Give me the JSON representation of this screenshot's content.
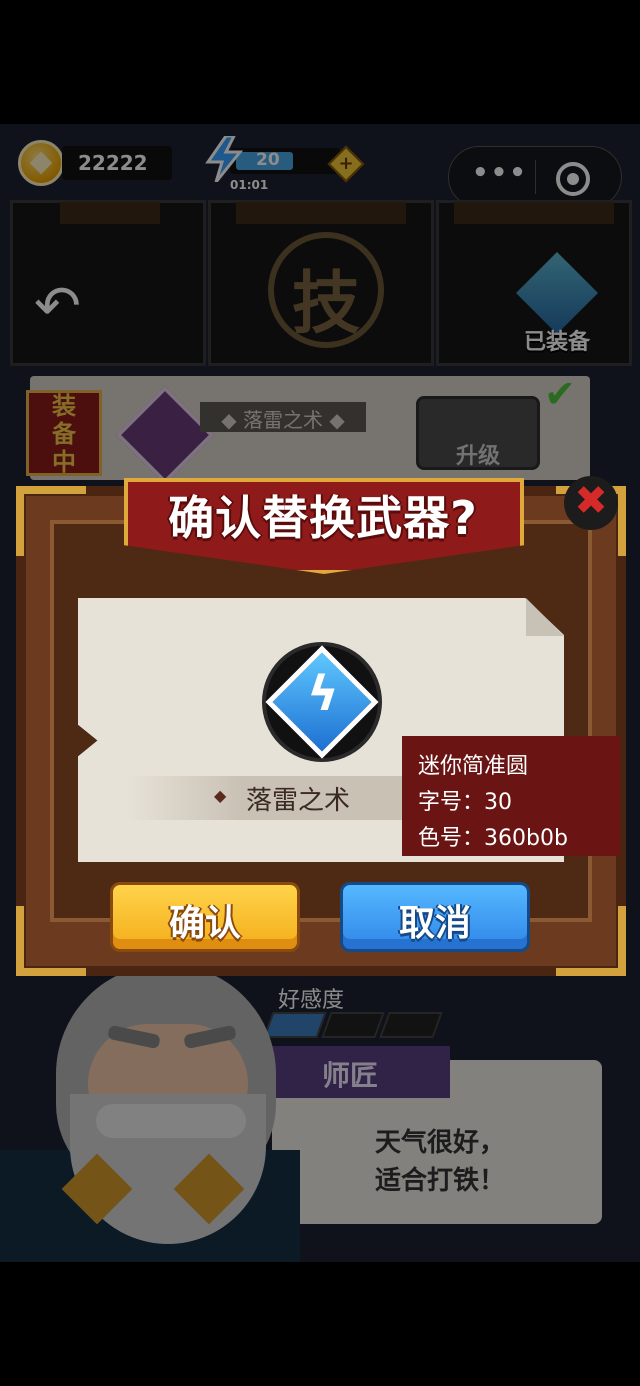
{
  "status_bar": {
    "coins": "22222",
    "energy": "20",
    "energy_timer": "01:01",
    "energy_fill_fraction": 0.55,
    "more_icon": "•••",
    "plus_icon": "+"
  },
  "header": {
    "back_icon": "↶",
    "skill_char": "技",
    "equipped_label": "已装备"
  },
  "equipped_card": {
    "tag": "装备中",
    "name": "◆ 落雷之术 ◆",
    "upgrade_label": "升级",
    "check_icon": "✔"
  },
  "modal": {
    "title": "确认替换武器?",
    "close_icon": "✖",
    "weapon_icon": "ϟ",
    "weapon_diamond": "◆",
    "weapon_name": "落雷之术",
    "confirm_label": "确认",
    "cancel_label": "取消"
  },
  "scene": {
    "favor_label": "好感度",
    "favor_level": 1,
    "favor_max": 3,
    "npc_title": "师匠",
    "npc_line1": "天气很好，",
    "npc_line2": "适合打铁！"
  },
  "annotation": {
    "line1": "迷你简准圆",
    "line2": "字号：30",
    "line3": "色号：360b0b"
  },
  "colors": {
    "accent_red": "#8e1a1a",
    "gold": "#d4a23c",
    "annotation_bg": "#6a1414",
    "favor_fill": "#3c7fc0"
  }
}
